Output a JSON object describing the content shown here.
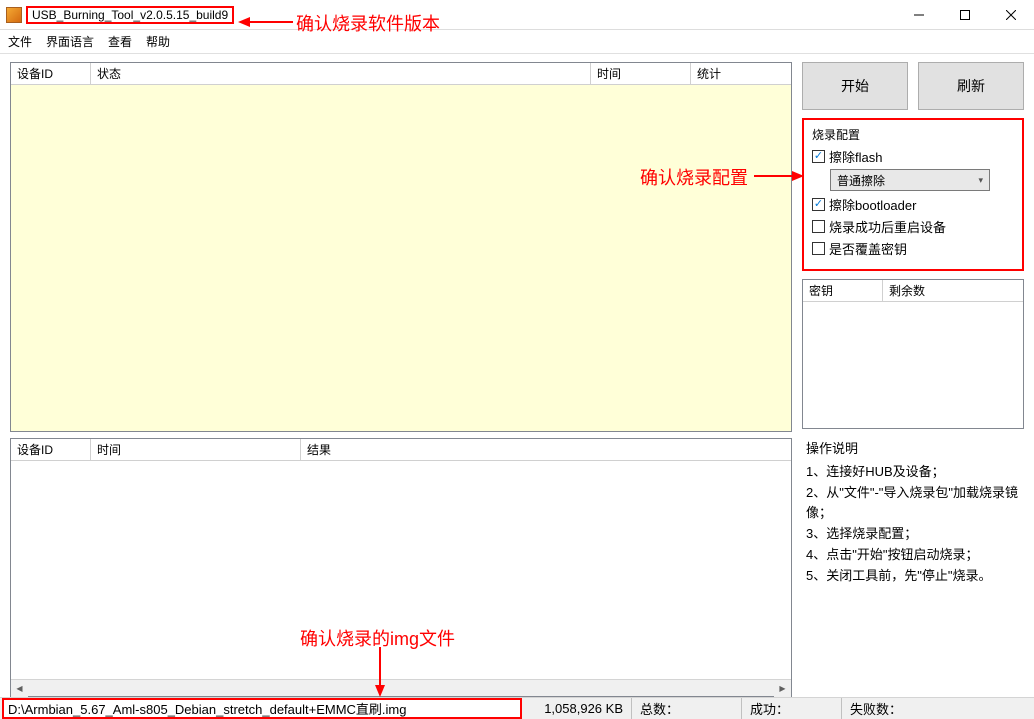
{
  "window": {
    "title": "USB_Burning_Tool_v2.0.5.15_build9"
  },
  "menu": {
    "file": "文件",
    "language": "界面语言",
    "view": "查看",
    "help": "帮助"
  },
  "annotations": {
    "version": "确认烧录软件版本",
    "config": "确认烧录配置",
    "imgfile": "确认烧录的img文件"
  },
  "top_table": {
    "col_device_id": "设备ID",
    "col_status": "状态",
    "col_time": "时间",
    "col_stats": "统计"
  },
  "bottom_table": {
    "col_device_id": "设备ID",
    "col_time": "时间",
    "col_result": "结果"
  },
  "buttons": {
    "start": "开始",
    "refresh": "刷新"
  },
  "config": {
    "title": "烧录配置",
    "erase_flash": "擦除flash",
    "erase_mode": "普通擦除",
    "erase_bootloader": "擦除bootloader",
    "reboot_after": "烧录成功后重启设备",
    "overwrite_key": "是否覆盖密钥"
  },
  "key_table": {
    "col_key": "密钥",
    "col_remaining": "剩余数"
  },
  "instructions": {
    "title": "操作说明",
    "step1": "1、连接好HUB及设备；",
    "step2": "2、从\"文件\"-\"导入烧录包\"加载烧录镜像；",
    "step3": "3、选择烧录配置；",
    "step4": "4、点击\"开始\"按钮启动烧录；",
    "step5": "5、关闭工具前，先\"停止\"烧录。"
  },
  "statusbar": {
    "filepath": "D:\\Armbian_5.67_Aml-s805_Debian_stretch_default+EMMC直刷.img",
    "filesize": "1,058,926 KB",
    "total_label": "总数：",
    "success_label": "成功：",
    "fail_label": "失败数："
  }
}
